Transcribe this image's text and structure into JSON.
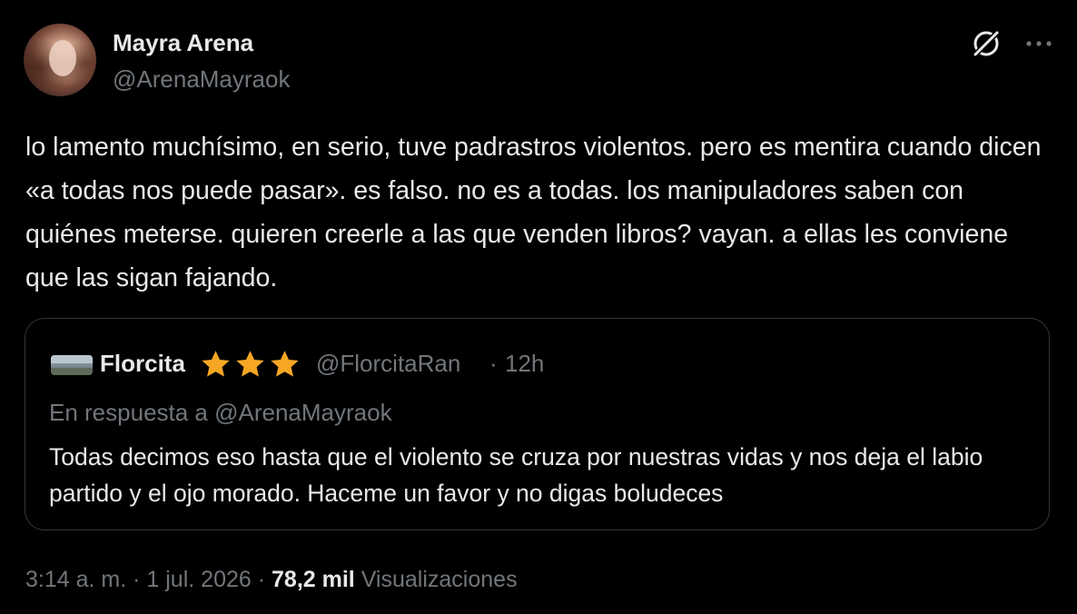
{
  "author": {
    "display_name": "Mayra Arena",
    "handle": "@ArenaMayraok"
  },
  "actions": {
    "grok_icon": "grok-icon",
    "more_icon": "more-icon"
  },
  "tweet": {
    "text": "lo lamento muchísimo, en serio, tuve padrastros violentos. pero es mentira cuando dicen «a todas nos puede pasar». es falso. no es a todas. los manipuladores saben con quiénes meterse. quieren creerle a las que venden libros? vayan. a ellas les conviene que las sigan fajando."
  },
  "quote": {
    "display_name": "Florcita",
    "stars": [
      "⭐",
      "⭐",
      "⭐"
    ],
    "handle": "@FlorcitaRan",
    "separator": "·",
    "time": "12h",
    "reply_to": "En respuesta a @ArenaMayraok",
    "text": "Todas decimos eso hasta que el violento se cruza por nuestras vidas y nos deja el labio partido y el ojo morado. Haceme un favor y no digas boludeces"
  },
  "meta": {
    "time": "3:14 a. m.",
    "separator": "·",
    "date": "1 jul. 2026",
    "views_count": "78,2 mil",
    "views_label": "Visualizaciones"
  },
  "colors": {
    "background": "#000000",
    "text_primary": "#e7e9ea",
    "text_secondary": "#71767b",
    "border": "#333639",
    "star": "#f5a623"
  }
}
